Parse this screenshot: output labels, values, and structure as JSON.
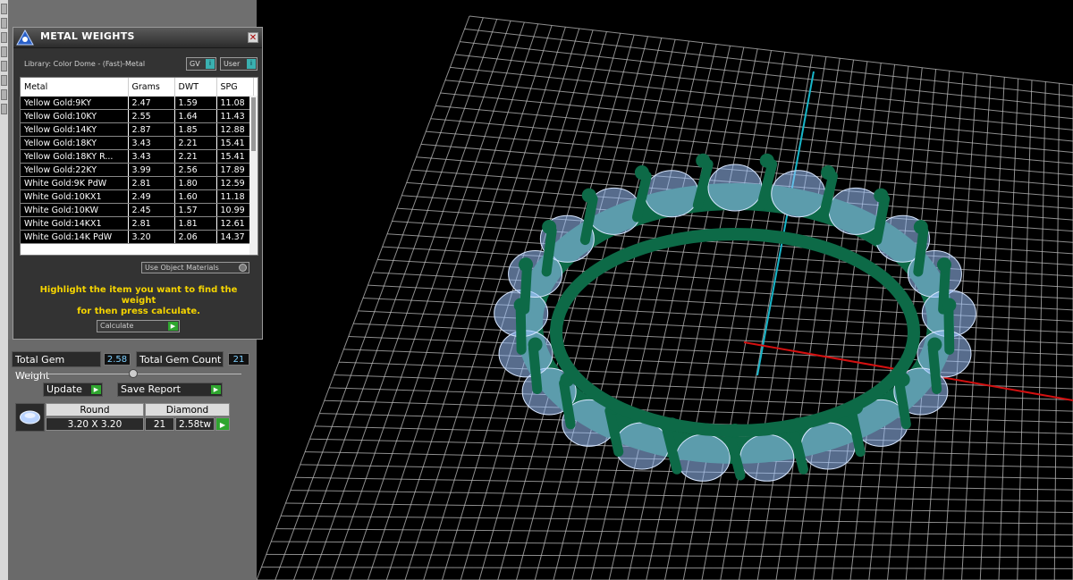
{
  "dialog": {
    "title": "METAL WEIGHTS",
    "close": "✕",
    "library_label": "Library: Color Dome - (Fast)-Metal",
    "toggle_gv": "GV",
    "toggle_user": "User",
    "columns": [
      "Metal",
      "Grams",
      "DWT",
      "SPG"
    ],
    "rows": [
      [
        "Yellow Gold:9KY",
        "2.47",
        "1.59",
        "11.08"
      ],
      [
        "Yellow Gold:10KY",
        "2.55",
        "1.64",
        "11.43"
      ],
      [
        "Yellow Gold:14KY",
        "2.87",
        "1.85",
        "12.88"
      ],
      [
        "Yellow Gold:18KY",
        "3.43",
        "2.21",
        "15.41"
      ],
      [
        "Yellow Gold:18KY R...",
        "3.43",
        "2.21",
        "15.41"
      ],
      [
        "Yellow Gold:22KY",
        "3.99",
        "2.56",
        "17.89"
      ],
      [
        "White Gold:9K PdW",
        "2.81",
        "1.80",
        "12.59"
      ],
      [
        "White Gold:10KX1",
        "2.49",
        "1.60",
        "11.18"
      ],
      [
        "White Gold:10KW",
        "2.45",
        "1.57",
        "10.99"
      ],
      [
        "White Gold:14KX1",
        "2.81",
        "1.81",
        "12.61"
      ],
      [
        "White Gold:14K PdW",
        "3.20",
        "2.06",
        "14.37"
      ]
    ],
    "use_object_materials": "Use Object Materials",
    "hint_line1": "Highlight the item you want to find the weight",
    "hint_line2": "for then press calculate.",
    "calculate": "Calculate"
  },
  "summary": {
    "total_gem_weight_label": "Total Gem Weight",
    "total_gem_weight_value": "2.58",
    "total_gem_count_label": "Total Gem Count",
    "total_gem_count_value": "21",
    "update": "Update",
    "save_report": "Save Report"
  },
  "gem": {
    "shape": "Round",
    "size": "3.20 X 3.20",
    "type": "Diamond",
    "count": "21",
    "weight": "2.58tw"
  },
  "colors": {
    "metal": "#0d6a47",
    "gem": "#9fc4ff",
    "hint": "#f5d400",
    "axis_x": "#d41010",
    "axis_z": "#18b6c9",
    "grid": "#bdbdbd"
  }
}
